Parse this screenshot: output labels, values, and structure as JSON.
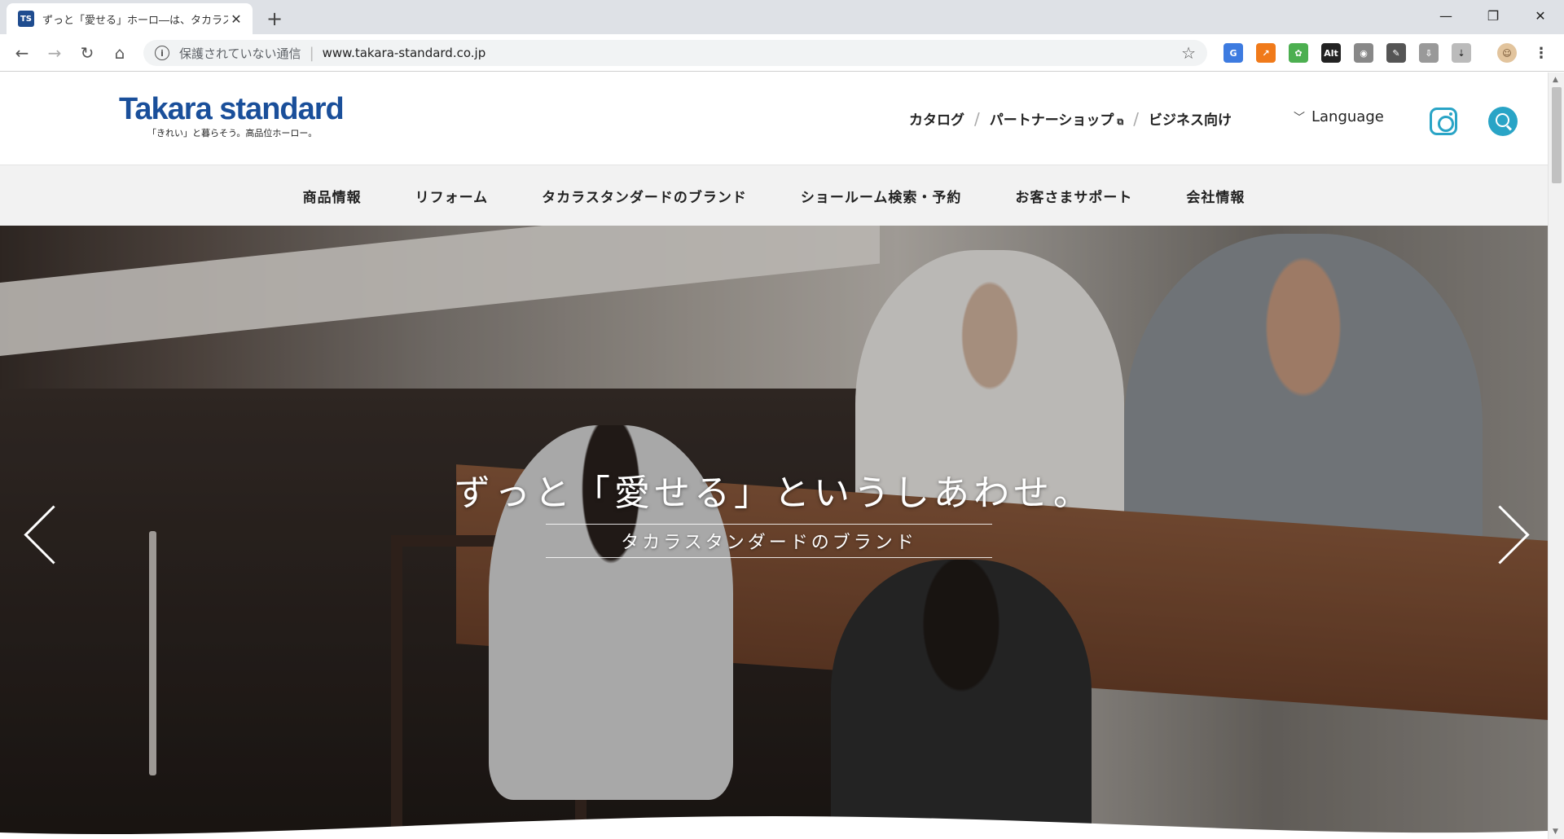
{
  "browser": {
    "tab_title": "ずっと「愛せる」ホーロ―は、タカラスタンダード",
    "tab_icon": "takara-favicon",
    "new_tab_label": "+",
    "security_text": "保護されていない通信",
    "url": "www.takara-standard.co.jp",
    "window_controls": [
      "minimize",
      "restore",
      "close"
    ]
  },
  "header": {
    "logo_text": "Takara standard",
    "logo_tagline": "「きれい」と暮らそう。高品位ホーロー。",
    "util_links": [
      "カタログ",
      "パートナーショップ",
      "ビジネス向け"
    ],
    "language_label": "Language",
    "brand_color": "#1a4f9a",
    "accent_color": "#29a4c6"
  },
  "global_nav": [
    "商品情報",
    "リフォーム",
    "タカラスタンダードのブランド",
    "ショールーム検索・予約",
    "お客さまサポート",
    "会社情報"
  ],
  "hero": {
    "headline": "ずっと「愛せる」というしあわせ。",
    "subheading": "タカラスタンダードのブランド"
  }
}
